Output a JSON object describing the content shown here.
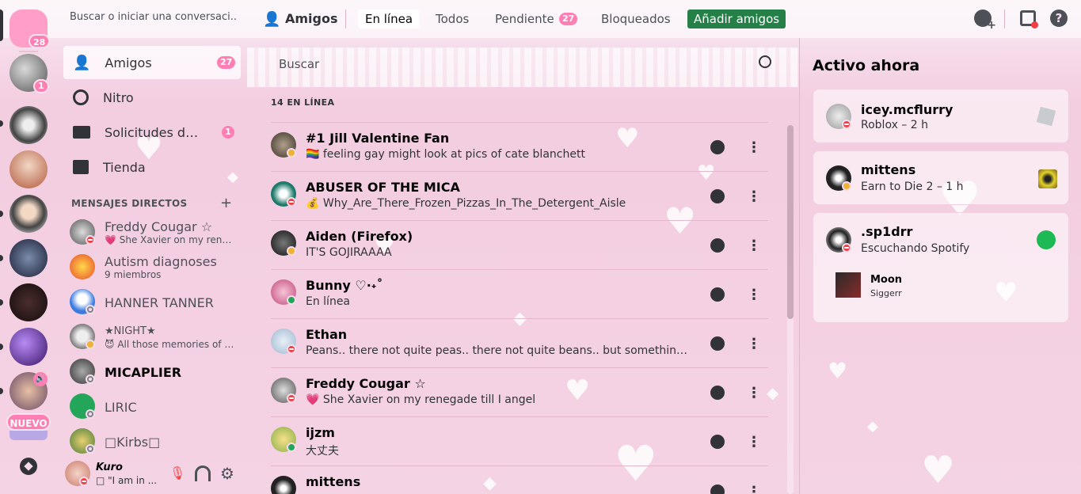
{
  "topbar": {
    "search_placeholder": "Buscar o iniciar una conversaci...",
    "title": "Amigos",
    "tabs": [
      {
        "label": "En línea",
        "selected": true
      },
      {
        "label": "Todos"
      },
      {
        "label": "Pendiente",
        "badge": "27"
      },
      {
        "label": "Bloqueados"
      }
    ],
    "add_friend_label": "Añadir amigos",
    "icons": [
      "new-group-dm-icon",
      "inbox-icon",
      "help-icon"
    ]
  },
  "rail": {
    "home_badge": "28",
    "server_badge": "1",
    "new_label": "NUEVO"
  },
  "sidebar": {
    "nav": [
      {
        "label": "Amigos",
        "badge": "27",
        "icon": "friends-icon"
      },
      {
        "label": "Nitro",
        "icon": "nitro-icon"
      },
      {
        "label": "Solicitudes de ...",
        "badge": "1",
        "icon": "mail-icon"
      },
      {
        "label": "Tienda",
        "icon": "shop-icon"
      }
    ],
    "dm_header": "MENSAJES DIRECTOS",
    "dms": [
      {
        "name": "Freddy Cougar ☆",
        "sub": "💗 She Xavier on my reneg...",
        "status": "dnd"
      },
      {
        "name": "Autism diagnoses",
        "sub": "9 miembros",
        "status": ""
      },
      {
        "name": "HANNER TANNER",
        "sub": "",
        "status": "off"
      },
      {
        "name": "★NIGHT★",
        "sub": "😈 All those memories of yo...",
        "status": "idle"
      },
      {
        "name": "MICAPLIER",
        "sub": "",
        "status": "off"
      },
      {
        "name": "LIRIC",
        "sub": "",
        "status": "off"
      },
      {
        "name": "□Kirbs□",
        "sub": "",
        "status": "off"
      }
    ],
    "user": {
      "name": "Kuro",
      "status_text": "□ \"I am in ..."
    }
  },
  "main": {
    "search_placeholder": "Buscar",
    "online_header": "14 EN LÍNEA",
    "friends": [
      {
        "name": "#1 Jill Valentine Fan",
        "status_text": "🏳️‍🌈 feeling gay might look at pics of cate blanchett",
        "status": "idle"
      },
      {
        "name": "ABUSER OF THE MICA",
        "status_text": "💰 Why_Are_There_Frozen_Pizzas_In_The_Detergent_Aisle",
        "status": "dnd"
      },
      {
        "name": "Aiden (Firefox)",
        "status_text": "IT'S GOJIRAAAA",
        "status": "idle"
      },
      {
        "name": "Bunny ♡·˖˚",
        "status_text": "En línea",
        "status": "on"
      },
      {
        "name": "Ethan",
        "status_text": "Peans.. there not quite peas.. there not quite beans.. but something special i...",
        "status": "dnd"
      },
      {
        "name": "Freddy Cougar ☆",
        "status_text": "💗 She Xavier on my renegade till I angel",
        "status": "dnd"
      },
      {
        "name": "ijzm",
        "status_text": "大丈夫",
        "status": "on"
      },
      {
        "name": "mittens",
        "status_text": "",
        "status": "idle"
      }
    ]
  },
  "active_now": {
    "title": "Activo ahora",
    "cards": [
      {
        "name": "icey.mcflurry",
        "activity": "Roblox – 2 h",
        "status": "dnd",
        "app_icon": "roblox-icon"
      },
      {
        "name": "mittens",
        "activity": "Earn to Die 2 – 1 h",
        "status": "idle",
        "app_icon": "game-icon"
      },
      {
        "name": ".sp1drr",
        "activity": "Escuchando Spotify",
        "status": "dnd",
        "app_icon": "spotify-icon",
        "track": "Moon",
        "artist": "Siggerr"
      }
    ]
  },
  "colors": {
    "accent_green": "#248046",
    "badge_pink": "#ff7eb3",
    "dnd": "#f23f43",
    "online": "#23a55a",
    "idle": "#f0b232"
  }
}
